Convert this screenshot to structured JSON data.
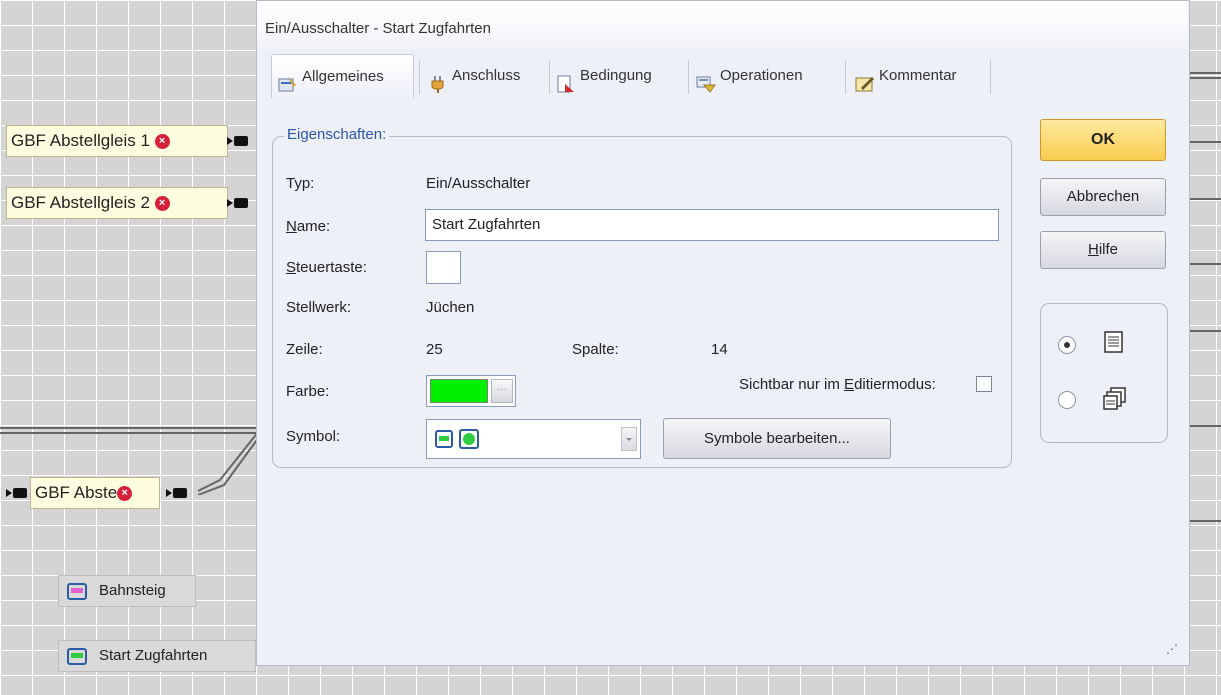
{
  "background": {
    "blocks": [
      {
        "label": "GBF Abstellgleis 1",
        "badge": "×"
      },
      {
        "label": "GBF Abstellgleis 2",
        "badge": "×"
      },
      {
        "label": "GBF Abste",
        "badge": "×"
      }
    ],
    "legend": [
      {
        "label": "Bahnsteig",
        "color": "#e060d0"
      },
      {
        "label": "Start Zugfahrten",
        "color": "#2ecc40"
      }
    ]
  },
  "dialog": {
    "title": "Ein/Ausschalter - Start Zugfahrten",
    "tabs": [
      {
        "label": "Allgemeines",
        "icon": "general-settings-icon",
        "active": true
      },
      {
        "label": "Anschluss",
        "icon": "plug-icon"
      },
      {
        "label": "Bedingung",
        "icon": "condition-icon"
      },
      {
        "label": "Operationen",
        "icon": "operations-icon"
      },
      {
        "label": "Kommentar",
        "icon": "comment-icon"
      }
    ],
    "group_title": "Eigenschaften:",
    "fields": {
      "typ_label": "Typ:",
      "typ_value": "Ein/Ausschalter",
      "name_label_u": "N",
      "name_label_rest": "ame:",
      "name_value": "Start Zugfahrten",
      "steuer_label_u": "S",
      "steuer_label_rest": "teuertaste:",
      "stellwerk_label": "Stellwerk:",
      "stellwerk_value": "Jüchen",
      "zeile_label": "Zeile:",
      "zeile_value": "25",
      "spalte_label": "Spalte:",
      "spalte_value": "14",
      "farbe_label": "Farbe:",
      "farbe_color": "#00f000",
      "sichtbar_pre": "Sichtbar nur im ",
      "sichtbar_u": "E",
      "sichtbar_post": "ditiermodus:",
      "symbol_label": "Symbol:",
      "symbol_edit_button": "Symbole bearbeiten..."
    },
    "buttons": {
      "ok": "OK",
      "cancel": "Abbrechen",
      "help_u": "H",
      "help_rest": "ilfe"
    },
    "view_mode": {
      "selected": "list"
    },
    "accent_color": "#2b56a6"
  }
}
